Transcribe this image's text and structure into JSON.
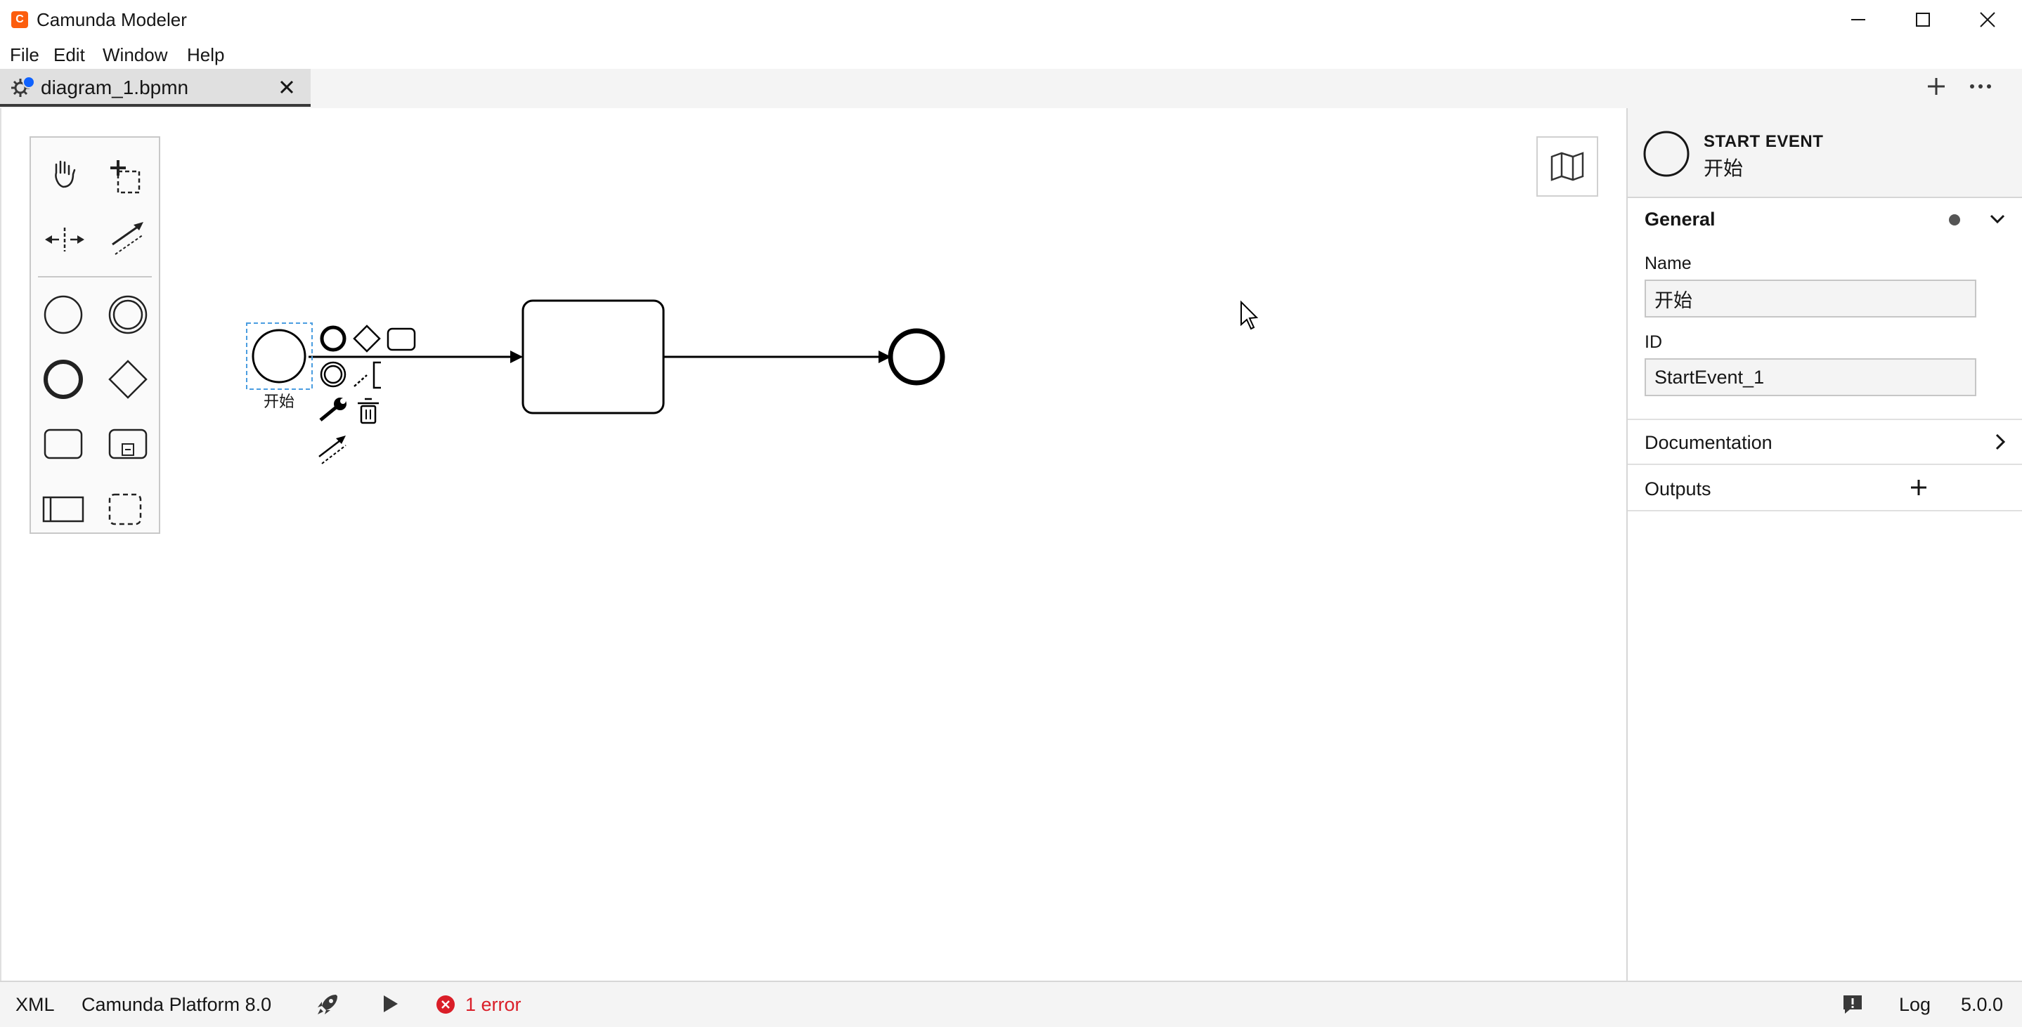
{
  "app": {
    "title": "Camunda Modeler",
    "logo": "C"
  },
  "menu": [
    "File",
    "Edit",
    "Window",
    "Help"
  ],
  "tabs": [
    {
      "label": "diagram_1.bpmn",
      "active": true,
      "unsaved": true
    }
  ],
  "canvas": {
    "start_event_label": "开始",
    "palette_tools": [
      "hand-tool",
      "lasso-tool",
      "space-tool",
      "global-connect-tool",
      "start-event",
      "intermediate-event",
      "end-event",
      "gateway",
      "task",
      "subprocess",
      "pool",
      "group"
    ],
    "context_pad": [
      "end-event",
      "gateway",
      "task",
      "intermediate-event",
      "text-annotation",
      "change-type",
      "delete",
      "connect"
    ]
  },
  "properties": {
    "type": "START EVENT",
    "name": "开始",
    "general": {
      "title": "General",
      "name_label": "Name",
      "name_value": "开始",
      "id_label": "ID",
      "id_value": "StartEvent_1"
    },
    "documentation_title": "Documentation",
    "outputs_title": "Outputs"
  },
  "status": {
    "xml": "XML",
    "platform": "Camunda Platform 8.0",
    "error": "1 error",
    "log": "Log",
    "version": "5.0.0"
  },
  "colors": {
    "accent": "#0f62fe",
    "error": "#da1e28",
    "brand": "#fc5d0d",
    "selection": "#4a9de0"
  }
}
